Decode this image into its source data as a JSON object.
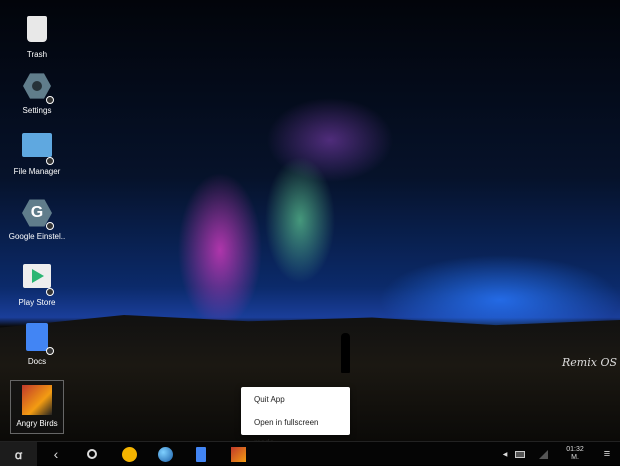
{
  "desktop": {
    "icons": [
      {
        "label": "Trash",
        "icon": "trash-icon"
      },
      {
        "label": "Settings",
        "icon": "gear-icon"
      },
      {
        "label": "File Manager",
        "icon": "folder-icon"
      },
      {
        "label": "Google Einstel..",
        "icon": "google-settings-icon"
      },
      {
        "label": "Play Store",
        "icon": "play-store-icon"
      },
      {
        "label": "Docs",
        "icon": "docs-icon"
      },
      {
        "label": "Angry Birds",
        "icon": "angry-birds-icon"
      }
    ],
    "watermark": "Remix OS"
  },
  "context_menu": {
    "items": [
      "Quit App",
      "Open in fullscreen mode"
    ]
  },
  "taskbar": {
    "clock_time": "01:32",
    "clock_period": "M.",
    "accent": "#f5b400"
  }
}
